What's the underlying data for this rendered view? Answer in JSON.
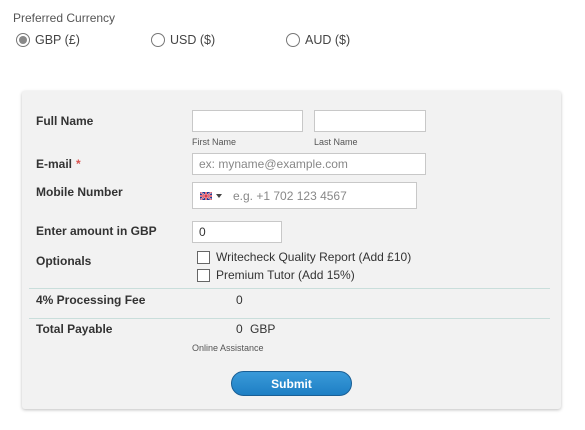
{
  "currency": {
    "title": "Preferred Currency",
    "options": [
      {
        "label": "GBP (£)",
        "selected": true
      },
      {
        "label": "USD ($)",
        "selected": false
      },
      {
        "label": "AUD ($)",
        "selected": false
      }
    ]
  },
  "form": {
    "full_name_label": "Full Name",
    "first_name_sublabel": "First Name",
    "last_name_sublabel": "Last Name",
    "first_name_value": "",
    "last_name_value": "",
    "email_label": "E-mail",
    "email_required_mark": "*",
    "email_placeholder": "ex: myname@example.com",
    "mobile_label": "Mobile Number",
    "mobile_placeholder": "e.g. +1 702 123 4567",
    "amount_label": "Enter amount in GBP",
    "amount_value": "0",
    "optionals_label": "Optionals",
    "optionals": [
      {
        "label": "Writecheck Quality Report (Add £10)",
        "checked": false
      },
      {
        "label": "Premium Tutor (Add 15%)",
        "checked": false
      }
    ],
    "processing_fee_label": "4% Processing Fee",
    "processing_fee_value": "0",
    "total_label": "Total Payable",
    "total_value": "0",
    "total_currency": "GBP",
    "total_note": "Online Assistance",
    "submit_label": "Submit"
  },
  "colors": {
    "accent": "#2a8dd4",
    "required": "#d9534f",
    "card_bg": "#f2f2f2",
    "divider": "#c9dedb"
  }
}
